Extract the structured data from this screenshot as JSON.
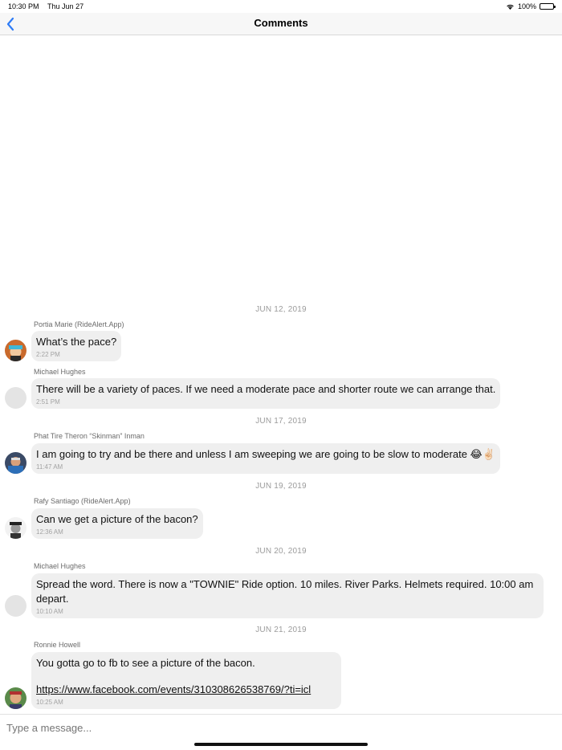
{
  "status": {
    "time": "10:30 PM",
    "date": "Thu Jun 27",
    "battery": "100%"
  },
  "nav": {
    "title": "Comments",
    "back_icon": "chevron-left-icon",
    "accent_color": "#2f7cf6"
  },
  "dates": [
    "JUN 12, 2019",
    "JUN 17, 2019",
    "JUN 19, 2019",
    "JUN 20, 2019",
    "JUN 21, 2019"
  ],
  "messages": [
    {
      "sender": "Portia Marie (RideAlert.App)",
      "text": "What’s the pace?",
      "time": "2:22 PM"
    },
    {
      "sender": "Michael Hughes",
      "text": "There will be a variety of paces. If we need a moderate pace and shorter route we can arrange that.",
      "time": "2:51 PM"
    },
    {
      "sender": "Phat Tire Theron “Skinman” Inman",
      "text": "I am going to try and be there and unless I am sweeping we are going to be slow to moderate 😂✌🏻",
      "time": "11:47 AM"
    },
    {
      "sender": "Rafy Santiago (RideAlert.App)",
      "text": "Can we get a picture of the bacon?",
      "time": "12:36 AM"
    },
    {
      "sender": "Michael Hughes",
      "text": "Spread the word. There is now a \"TOWNIE\" Ride option. 10 miles. River Parks. Helmets required. 10:00 am\ndepart.",
      "time": "10:10 AM"
    },
    {
      "sender": "Ronnie Howell",
      "text": "You gotta go to fb to see a picture of the bacon.",
      "link": "https://www.facebook.com/events/310308626538769/?ti=icl",
      "time": "10:25 AM"
    }
  ],
  "composer": {
    "placeholder": "Type a message..."
  }
}
